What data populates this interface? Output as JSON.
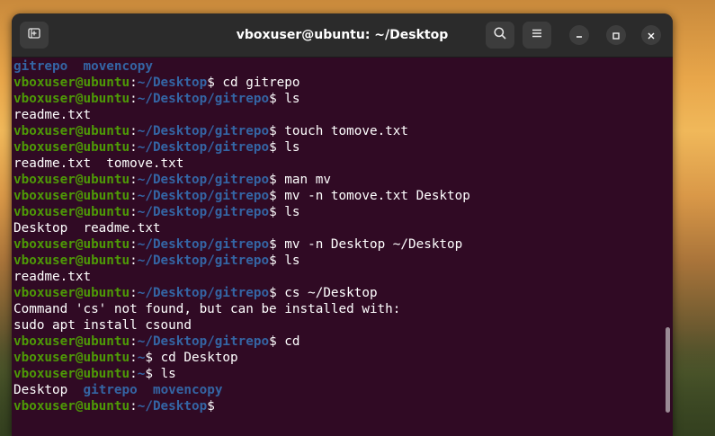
{
  "window": {
    "title": "vboxuser@ubuntu: ~/Desktop"
  },
  "headerbar": {
    "new_tab_icon": "new-tab-icon",
    "search_icon": "search-icon",
    "menu_icon": "hamburger-menu-icon",
    "minimize_icon": "minimize-icon",
    "maximize_icon": "maximize-icon",
    "close_icon": "close-icon"
  },
  "colors": {
    "terminal_bg": "#300a24",
    "user_host": "#4e9a06",
    "path": "#3465a4",
    "text": "#ffffff"
  },
  "terminal": {
    "lines": [
      {
        "type": "dirs",
        "parts": [
          {
            "t": "gitrepo",
            "c": "d"
          },
          {
            "t": "  ",
            "c": ""
          },
          {
            "t": "movencopy",
            "c": "d"
          }
        ]
      },
      {
        "type": "prompt",
        "user": "vboxuser@ubuntu",
        "sep": ":",
        "path": "~/Desktop",
        "sym": "$ ",
        "cmd": "cd gitrepo"
      },
      {
        "type": "prompt",
        "user": "vboxuser@ubuntu",
        "sep": ":",
        "path": "~/Desktop/gitrepo",
        "sym": "$ ",
        "cmd": "ls"
      },
      {
        "type": "out",
        "text": "readme.txt"
      },
      {
        "type": "prompt",
        "user": "vboxuser@ubuntu",
        "sep": ":",
        "path": "~/Desktop/gitrepo",
        "sym": "$ ",
        "cmd": "touch tomove.txt"
      },
      {
        "type": "prompt",
        "user": "vboxuser@ubuntu",
        "sep": ":",
        "path": "~/Desktop/gitrepo",
        "sym": "$ ",
        "cmd": "ls"
      },
      {
        "type": "out",
        "text": "readme.txt  tomove.txt"
      },
      {
        "type": "prompt",
        "user": "vboxuser@ubuntu",
        "sep": ":",
        "path": "~/Desktop/gitrepo",
        "sym": "$ ",
        "cmd": "man mv"
      },
      {
        "type": "prompt",
        "user": "vboxuser@ubuntu",
        "sep": ":",
        "path": "~/Desktop/gitrepo",
        "sym": "$ ",
        "cmd": "mv -n tomove.txt Desktop"
      },
      {
        "type": "prompt",
        "user": "vboxuser@ubuntu",
        "sep": ":",
        "path": "~/Desktop/gitrepo",
        "sym": "$ ",
        "cmd": "ls"
      },
      {
        "type": "out",
        "text": "Desktop  readme.txt"
      },
      {
        "type": "prompt",
        "user": "vboxuser@ubuntu",
        "sep": ":",
        "path": "~/Desktop/gitrepo",
        "sym": "$ ",
        "cmd": "mv -n Desktop ~/Desktop"
      },
      {
        "type": "prompt",
        "user": "vboxuser@ubuntu",
        "sep": ":",
        "path": "~/Desktop/gitrepo",
        "sym": "$ ",
        "cmd": "ls"
      },
      {
        "type": "out",
        "text": "readme.txt"
      },
      {
        "type": "prompt",
        "user": "vboxuser@ubuntu",
        "sep": ":",
        "path": "~/Desktop/gitrepo",
        "sym": "$ ",
        "cmd": "cs ~/Desktop"
      },
      {
        "type": "out",
        "text": "Command 'cs' not found, but can be installed with:"
      },
      {
        "type": "out",
        "text": "sudo apt install csound"
      },
      {
        "type": "prompt",
        "user": "vboxuser@ubuntu",
        "sep": ":",
        "path": "~/Desktop/gitrepo",
        "sym": "$ ",
        "cmd": "cd"
      },
      {
        "type": "prompt",
        "user": "vboxuser@ubuntu",
        "sep": ":",
        "path": "~",
        "sym": "$ ",
        "cmd": "cd Desktop"
      },
      {
        "type": "prompt",
        "user": "vboxuser@ubuntu",
        "sep": ":",
        "path": "~",
        "sym": "$ ",
        "cmd": "ls"
      },
      {
        "type": "dirs",
        "parts": [
          {
            "t": "Desktop",
            "c": ""
          },
          {
            "t": "  ",
            "c": ""
          },
          {
            "t": "gitrepo",
            "c": "d"
          },
          {
            "t": "  ",
            "c": ""
          },
          {
            "t": "movencopy",
            "c": "d"
          }
        ]
      },
      {
        "type": "prompt",
        "user": "vboxuser@ubuntu",
        "sep": ":",
        "path": "~/Desktop",
        "sym": "$",
        "cmd": ""
      }
    ]
  }
}
